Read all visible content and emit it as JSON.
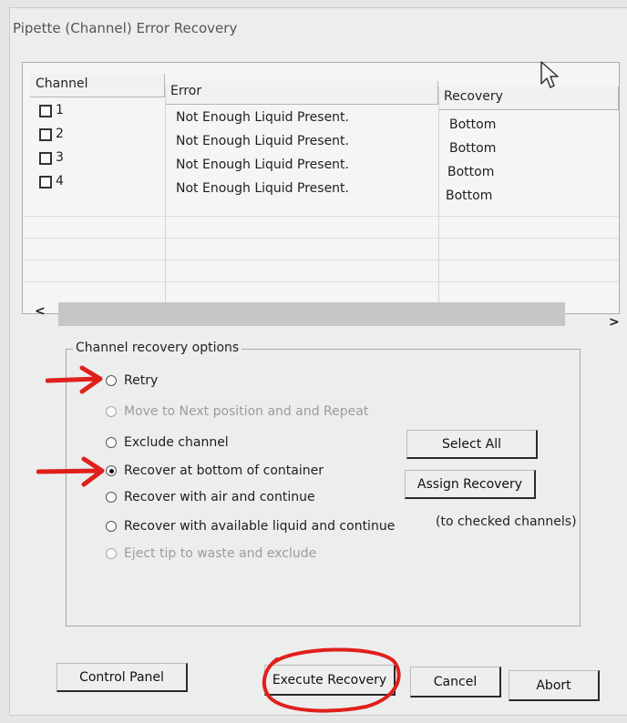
{
  "window": {
    "title": "Pipette (Channel) Error Recovery"
  },
  "table": {
    "headers": {
      "channel": "Channel",
      "error": "Error",
      "recovery": "Recovery"
    },
    "rows": [
      {
        "channel": "1",
        "error": "Not Enough Liquid Present.",
        "recovery": "Bottom",
        "checked": false
      },
      {
        "channel": "2",
        "error": "Not Enough Liquid Present.",
        "recovery": "Bottom",
        "checked": false
      },
      {
        "channel": "3",
        "error": "Not Enough Liquid Present.",
        "recovery": "Bottom",
        "checked": false
      },
      {
        "channel": "4",
        "error": "Not Enough Liquid Present.",
        "recovery": "Bottom",
        "checked": false
      }
    ],
    "scroll": {
      "left": "<",
      "right": ">"
    }
  },
  "options": {
    "legend": "Channel recovery options",
    "items": [
      {
        "label": "Retry",
        "selected": false,
        "enabled": true
      },
      {
        "label": "Move to Next position and  and Repeat",
        "selected": false,
        "enabled": false
      },
      {
        "label": "Exclude channel",
        "selected": false,
        "enabled": true
      },
      {
        "label": "Recover at bottom of container",
        "selected": true,
        "enabled": true
      },
      {
        "label": "Recover with air and continue",
        "selected": false,
        "enabled": true
      },
      {
        "label": "Recover with available liquid and continue",
        "selected": false,
        "enabled": true
      },
      {
        "label": "Eject tip to waste and exclude",
        "selected": false,
        "enabled": false
      }
    ],
    "select_all": "Select All",
    "assign_recovery": "Assign Recovery",
    "assign_note": "(to checked channels)"
  },
  "footer": {
    "control_panel": "Control Panel",
    "execute_recovery": "Execute Recovery",
    "cancel": "Cancel",
    "abort": "Abort"
  },
  "annotation_color": "#e0201c"
}
